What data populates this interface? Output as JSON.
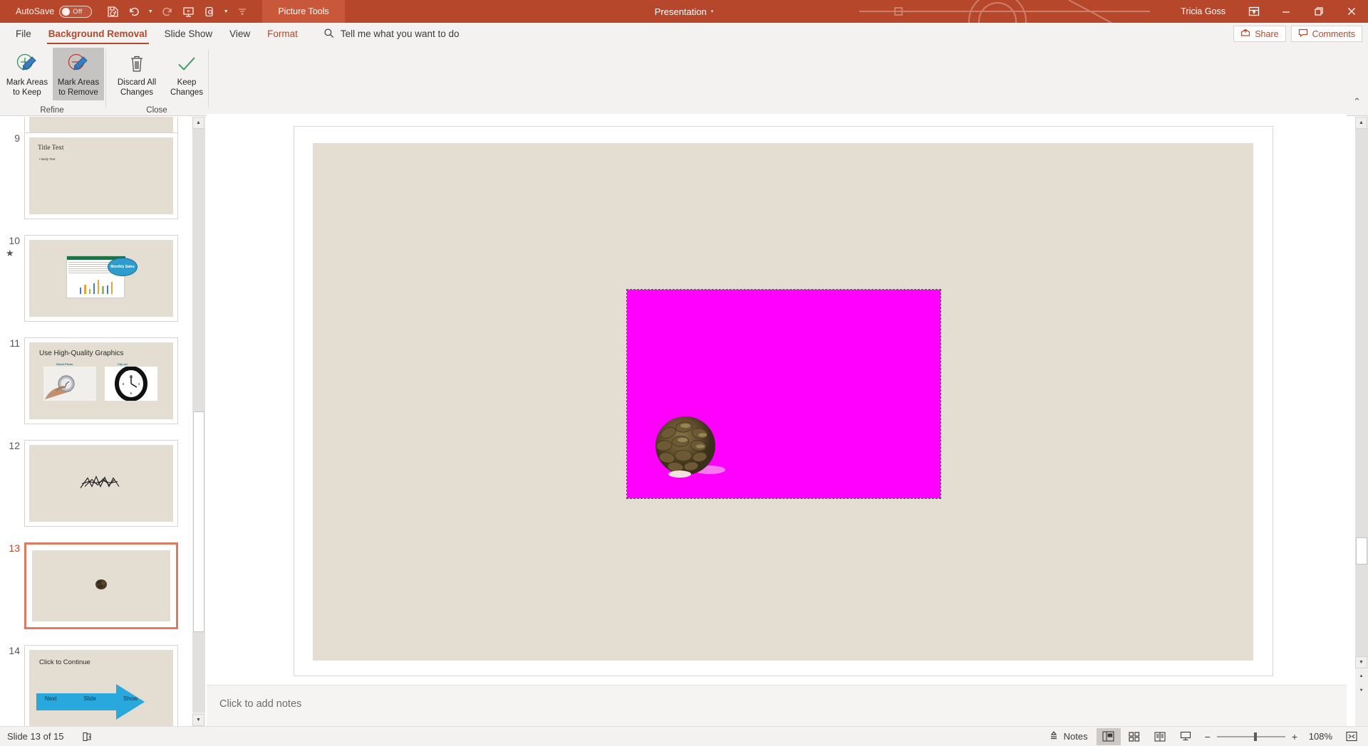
{
  "titlebar": {
    "autosave_label": "AutoSave",
    "autosave_state": "Off",
    "context_tab_band": "Picture Tools",
    "document_title": "Presentation",
    "document_caret": "▾",
    "username": "Tricia Goss",
    "qat": [
      {
        "name": "save-icon",
        "label": "Save"
      },
      {
        "name": "undo-icon",
        "label": "Undo"
      },
      {
        "name": "redo-icon",
        "label": "Redo"
      },
      {
        "name": "start-presentation-icon",
        "label": "Start From Beginning"
      },
      {
        "name": "touch-mode-icon",
        "label": "Touch/Mouse Mode"
      },
      {
        "name": "customize-quick-access-toolbar-icon",
        "label": "Customize Quick Access Toolbar"
      }
    ],
    "window_buttons": [
      {
        "name": "ribbon-display-options-icon",
        "glyph": "⊞"
      },
      {
        "name": "minimize-icon",
        "glyph": "—"
      },
      {
        "name": "restore-icon",
        "glyph": "❐"
      },
      {
        "name": "close-icon",
        "glyph": "✕"
      }
    ]
  },
  "ribbon": {
    "tabs": [
      {
        "label": "File",
        "state": "normal"
      },
      {
        "label": "Background Removal",
        "state": "active"
      },
      {
        "label": "Slide Show",
        "state": "normal"
      },
      {
        "label": "View",
        "state": "normal"
      },
      {
        "label": "Format",
        "state": "contextual"
      }
    ],
    "tellme_placeholder": "Tell me what you want to do",
    "share_label": "Share",
    "comments_label": "Comments",
    "collapse_glyph": "⌃",
    "groups": [
      {
        "name": "Refine",
        "buttons": [
          {
            "label_line1": "Mark Areas",
            "label_line2": "to Keep",
            "icon": "mark-areas-to-keep-icon",
            "selected": false
          },
          {
            "label_line1": "Mark Areas",
            "label_line2": "to Remove",
            "icon": "mark-areas-to-remove-icon",
            "selected": true
          }
        ]
      },
      {
        "name": "Close",
        "buttons": [
          {
            "label_line1": "Discard All",
            "label_line2": "Changes",
            "icon": "discard-all-changes-icon",
            "selected": false
          },
          {
            "label_line1": "Keep",
            "label_line2": "Changes",
            "icon": "keep-changes-icon",
            "selected": false
          }
        ]
      }
    ]
  },
  "thumbnails": [
    {
      "number": "9",
      "starred": false,
      "current": false,
      "kind": "title-body",
      "title": "Title Text",
      "body": "• Body Text"
    },
    {
      "number": "10",
      "starred": true,
      "current": false,
      "kind": "chart-callout",
      "callout": "Monthly Sales"
    },
    {
      "number": "11",
      "starred": false,
      "current": false,
      "kind": "graphics",
      "title": "Use High-Quality Graphics",
      "label_left": "Stock Photo",
      "label_right": "Clip art"
    },
    {
      "number": "12",
      "starred": false,
      "current": false,
      "kind": "wordart"
    },
    {
      "number": "13",
      "starred": false,
      "current": true,
      "kind": "pinecone"
    },
    {
      "number": "14",
      "starred": false,
      "current": false,
      "kind": "continue",
      "title": "Click to Continue",
      "word1": "Next",
      "word2": "Slide",
      "word3": "Show"
    }
  ],
  "slide": {
    "selection_fill_color": "#ff00ff",
    "background_color": "#e3ddd2",
    "picture_alt": "pine-cone-photo"
  },
  "notes": {
    "placeholder": "Click to add notes"
  },
  "statusbar": {
    "slide_count": "Slide 13 of 15",
    "language_icon": "accessibility-checker-icon",
    "notes_label": "Notes",
    "views": [
      {
        "name": "normal-view-icon",
        "active": true
      },
      {
        "name": "slide-sorter-view-icon",
        "active": false
      },
      {
        "name": "reading-view-icon",
        "active": false
      },
      {
        "name": "slide-show-view-icon",
        "active": false
      }
    ],
    "zoom_out": "−",
    "zoom_in": "+",
    "zoom_level": "108%",
    "fit_icon": "fit-slide-to-window-icon"
  },
  "colors": {
    "accent": "#b7472a",
    "context_band": "#c9583a",
    "selection_magenta": "#ff00ff",
    "current_thumb_border": "#e07a5f",
    "slide_bg": "#e3ddd2"
  }
}
